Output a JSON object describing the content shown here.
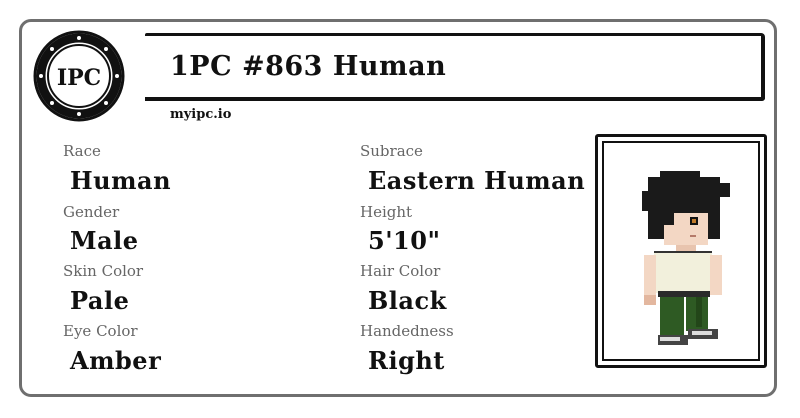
{
  "header": {
    "logo_text": "IPC",
    "title": "1PC #863 Human",
    "site": "myipc.io"
  },
  "fields": {
    "race": {
      "label": "Race",
      "value": "Human"
    },
    "subrace": {
      "label": "Subrace",
      "value": "Eastern Human"
    },
    "gender": {
      "label": "Gender",
      "value": "Male"
    },
    "height": {
      "label": "Height",
      "value": "5'10\""
    },
    "skin_color": {
      "label": "Skin Color",
      "value": "Pale"
    },
    "hair_color": {
      "label": "Hair Color",
      "value": "Black"
    },
    "eye_color": {
      "label": "Eye Color",
      "value": "Amber"
    },
    "handedness": {
      "label": "Handedness",
      "value": "Right"
    }
  },
  "colors": {
    "border": "#6f6f6f",
    "label": "#666666",
    "text": "#111111",
    "skin": "#f3d7c4",
    "shirt": "#f2f0dc",
    "pants": "#2e5a23",
    "hair": "#1a1a1a",
    "eye": "#c07a2a"
  },
  "icons": {
    "logo": "ipc-seal-icon",
    "portrait": "pixel-character-portrait"
  }
}
